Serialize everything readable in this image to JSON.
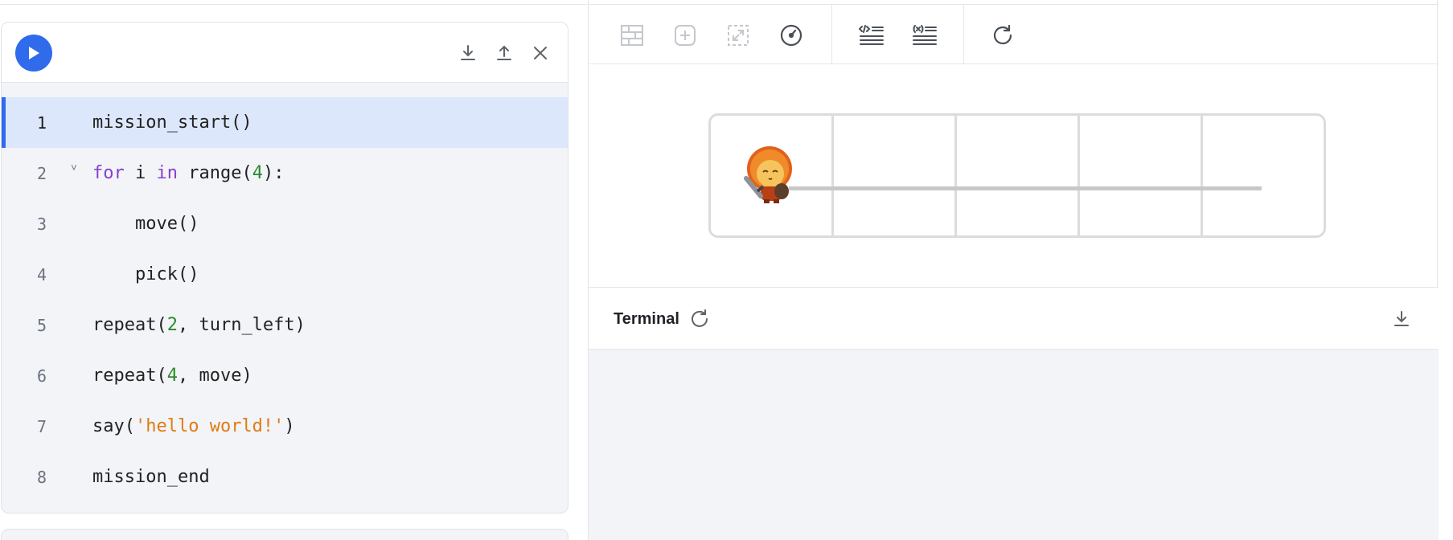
{
  "editor": {
    "lines": [
      {
        "num": "1",
        "code": "mission_start()"
      },
      {
        "num": "2",
        "code": "for i in range(4):",
        "kw1": "for",
        "mid1": " i ",
        "kw2": "in",
        "mid2": " range(",
        "n": "4",
        "end": "):"
      },
      {
        "num": "3",
        "code": "    move()"
      },
      {
        "num": "4",
        "code": "    pick()"
      },
      {
        "num": "5",
        "code": "repeat(2, turn_left)",
        "pre": "repeat(",
        "n": "2",
        "end": ", turn_left)"
      },
      {
        "num": "6",
        "code": "repeat(4, move)",
        "pre": "repeat(",
        "n": "4",
        "end": ", move)"
      },
      {
        "num": "7",
        "code": "say('hello world!')",
        "pre": "say(",
        "s": "'hello world!'",
        "end": ")"
      },
      {
        "num": "8",
        "code": "mission_end"
      }
    ],
    "active_line": "1",
    "fold_marker": "˅"
  },
  "header_icons": [
    "download-icon",
    "upload-icon",
    "close-icon"
  ],
  "toolbar_icons": [
    "grid-icon",
    "add-icon",
    "fit-icon",
    "speed-icon",
    "code-view-icon",
    "variables-view-icon",
    "refresh-icon"
  ],
  "terminal": {
    "title": "Terminal"
  },
  "colors": {
    "accent": "#2f6bea",
    "keyword": "#8a3fc9",
    "number": "#2b8a2b",
    "string": "#e07b12",
    "active_line_bg": "#dde7fc"
  }
}
